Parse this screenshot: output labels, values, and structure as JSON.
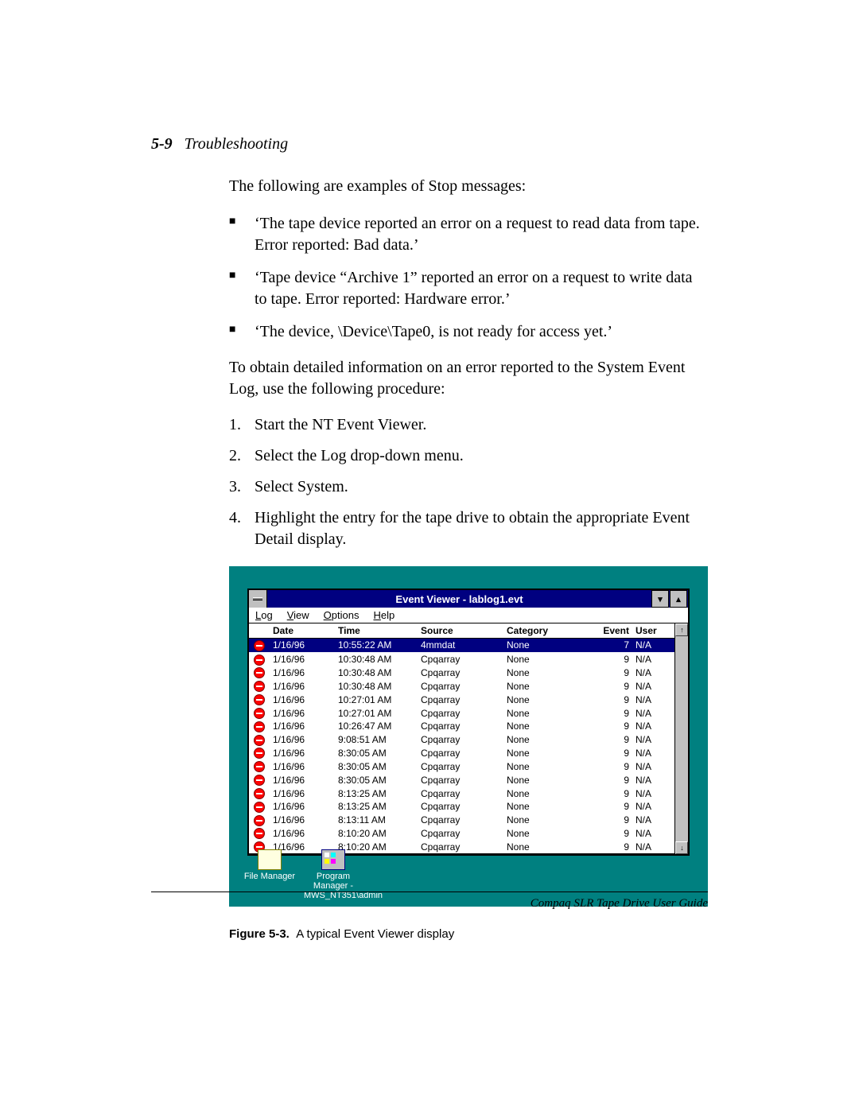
{
  "page": {
    "section_num": "5-9",
    "section_title": "Troubleshooting",
    "intro": "The following are examples of Stop messages:",
    "bullets": [
      "‘The tape device reported an error on a request to read data from tape. Error reported: Bad data.’",
      "‘Tape device “Archive 1” reported an error on a request to write data to tape. Error reported: Hardware error.’",
      "‘The device, \\Device\\Tape0, is not ready for access yet.’"
    ],
    "para2": "To obtain detailed information on an error reported to the System Event Log, use the following procedure:",
    "steps": [
      "Start the NT Event Viewer.",
      "Select the Log drop-down menu.",
      "Select System.",
      "Highlight the entry for the tape drive to obtain the appropriate Event Detail display."
    ],
    "figure_label": "Figure 5-3.",
    "figure_caption": "A typical Event Viewer display",
    "footer": "Compaq SLR Tape Drive User Guide"
  },
  "event_viewer": {
    "window_title": "Event Viewer - lablog1.evt",
    "min_glyph": "▾",
    "max_glyph": "▴",
    "menu": {
      "log_u": "L",
      "log_rest": "og",
      "view_u": "V",
      "view_rest": "iew",
      "options_u": "O",
      "options_rest": "ptions",
      "help_u": "H",
      "help_rest": "elp"
    },
    "columns": [
      "Date",
      "Time",
      "Source",
      "Category",
      "Event",
      "User"
    ],
    "rows": [
      {
        "date": "1/16/96",
        "time": "10:55:22 AM",
        "source": "4mmdat",
        "category": "None",
        "event": "7",
        "user": "N/A",
        "selected": true
      },
      {
        "date": "1/16/96",
        "time": "10:30:48 AM",
        "source": "Cpqarray",
        "category": "None",
        "event": "9",
        "user": "N/A"
      },
      {
        "date": "1/16/96",
        "time": "10:30:48 AM",
        "source": "Cpqarray",
        "category": "None",
        "event": "9",
        "user": "N/A"
      },
      {
        "date": "1/16/96",
        "time": "10:30:48 AM",
        "source": "Cpqarray",
        "category": "None",
        "event": "9",
        "user": "N/A"
      },
      {
        "date": "1/16/96",
        "time": "10:27:01 AM",
        "source": "Cpqarray",
        "category": "None",
        "event": "9",
        "user": "N/A"
      },
      {
        "date": "1/16/96",
        "time": "10:27:01 AM",
        "source": "Cpqarray",
        "category": "None",
        "event": "9",
        "user": "N/A"
      },
      {
        "date": "1/16/96",
        "time": "10:26:47 AM",
        "source": "Cpqarray",
        "category": "None",
        "event": "9",
        "user": "N/A"
      },
      {
        "date": "1/16/96",
        "time": "9:08:51 AM",
        "source": "Cpqarray",
        "category": "None",
        "event": "9",
        "user": "N/A"
      },
      {
        "date": "1/16/96",
        "time": "8:30:05 AM",
        "source": "Cpqarray",
        "category": "None",
        "event": "9",
        "user": "N/A"
      },
      {
        "date": "1/16/96",
        "time": "8:30:05 AM",
        "source": "Cpqarray",
        "category": "None",
        "event": "9",
        "user": "N/A"
      },
      {
        "date": "1/16/96",
        "time": "8:30:05 AM",
        "source": "Cpqarray",
        "category": "None",
        "event": "9",
        "user": "N/A"
      },
      {
        "date": "1/16/96",
        "time": "8:13:25 AM",
        "source": "Cpqarray",
        "category": "None",
        "event": "9",
        "user": "N/A"
      },
      {
        "date": "1/16/96",
        "time": "8:13:25 AM",
        "source": "Cpqarray",
        "category": "None",
        "event": "9",
        "user": "N/A"
      },
      {
        "date": "1/16/96",
        "time": "8:13:11 AM",
        "source": "Cpqarray",
        "category": "None",
        "event": "9",
        "user": "N/A"
      },
      {
        "date": "1/16/96",
        "time": "8:10:20 AM",
        "source": "Cpqarray",
        "category": "None",
        "event": "9",
        "user": "N/A"
      },
      {
        "date": "1/16/96",
        "time": "8:10:20 AM",
        "source": "Cpqarray",
        "category": "None",
        "event": "9",
        "user": "N/A"
      }
    ],
    "scroll_up": "↑",
    "scroll_down": "↓",
    "desktop_icons": {
      "file_manager": "File Manager",
      "program_manager_line1": "Program Manager -",
      "program_manager_line2": "MWS_NT351\\admin"
    }
  }
}
